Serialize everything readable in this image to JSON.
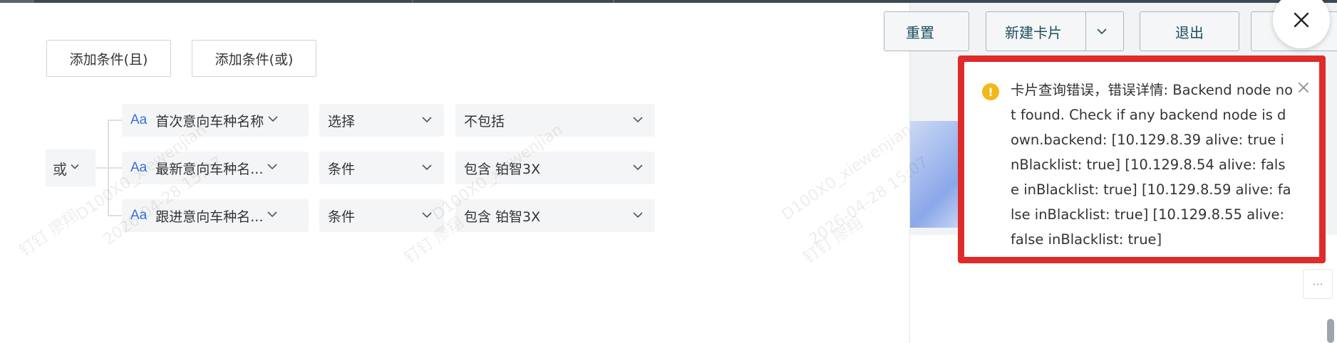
{
  "condition_buttons": {
    "add_and": "添加条件(且)",
    "add_or": "添加条件(或)"
  },
  "logic_operator": "或",
  "conditions": [
    {
      "field": "首次意向车种名称",
      "operator": "选择",
      "value": "不包括"
    },
    {
      "field": "最新意向车种名...",
      "operator": "条件",
      "value": "包含 铂智3X"
    },
    {
      "field": "跟进意向车种名...",
      "operator": "条件",
      "value": "包含 铂智3X"
    }
  ],
  "field_type_badge": "Aa",
  "toolbar": {
    "reset": "重置",
    "new_card": "新建卡片",
    "exit": "退出"
  },
  "toast": {
    "message": "卡片查询错误，错误详情: Backend node not found. Check if any backend node is down.backend: [10.129.8.39 alive: true inBlacklist: true] [10.129.8.54 alive: false inBlacklist: true] [10.129.8.59 alive: false inBlacklist: true] [10.129.8.55 alive: false inBlacklist: true]"
  },
  "watermark": {
    "name": "D100X0_xiewenjian",
    "date": "2026-04-28 15:07",
    "app": "钉钉 廖翔"
  },
  "icons": {
    "close": "close-icon",
    "warning": "warning-icon",
    "dropdown": "chevron-down-icon",
    "more": "more-icon"
  },
  "colors": {
    "highlight_border": "#df2b2b",
    "warning": "#f1b81b",
    "field_badge": "#3b6fd9"
  }
}
